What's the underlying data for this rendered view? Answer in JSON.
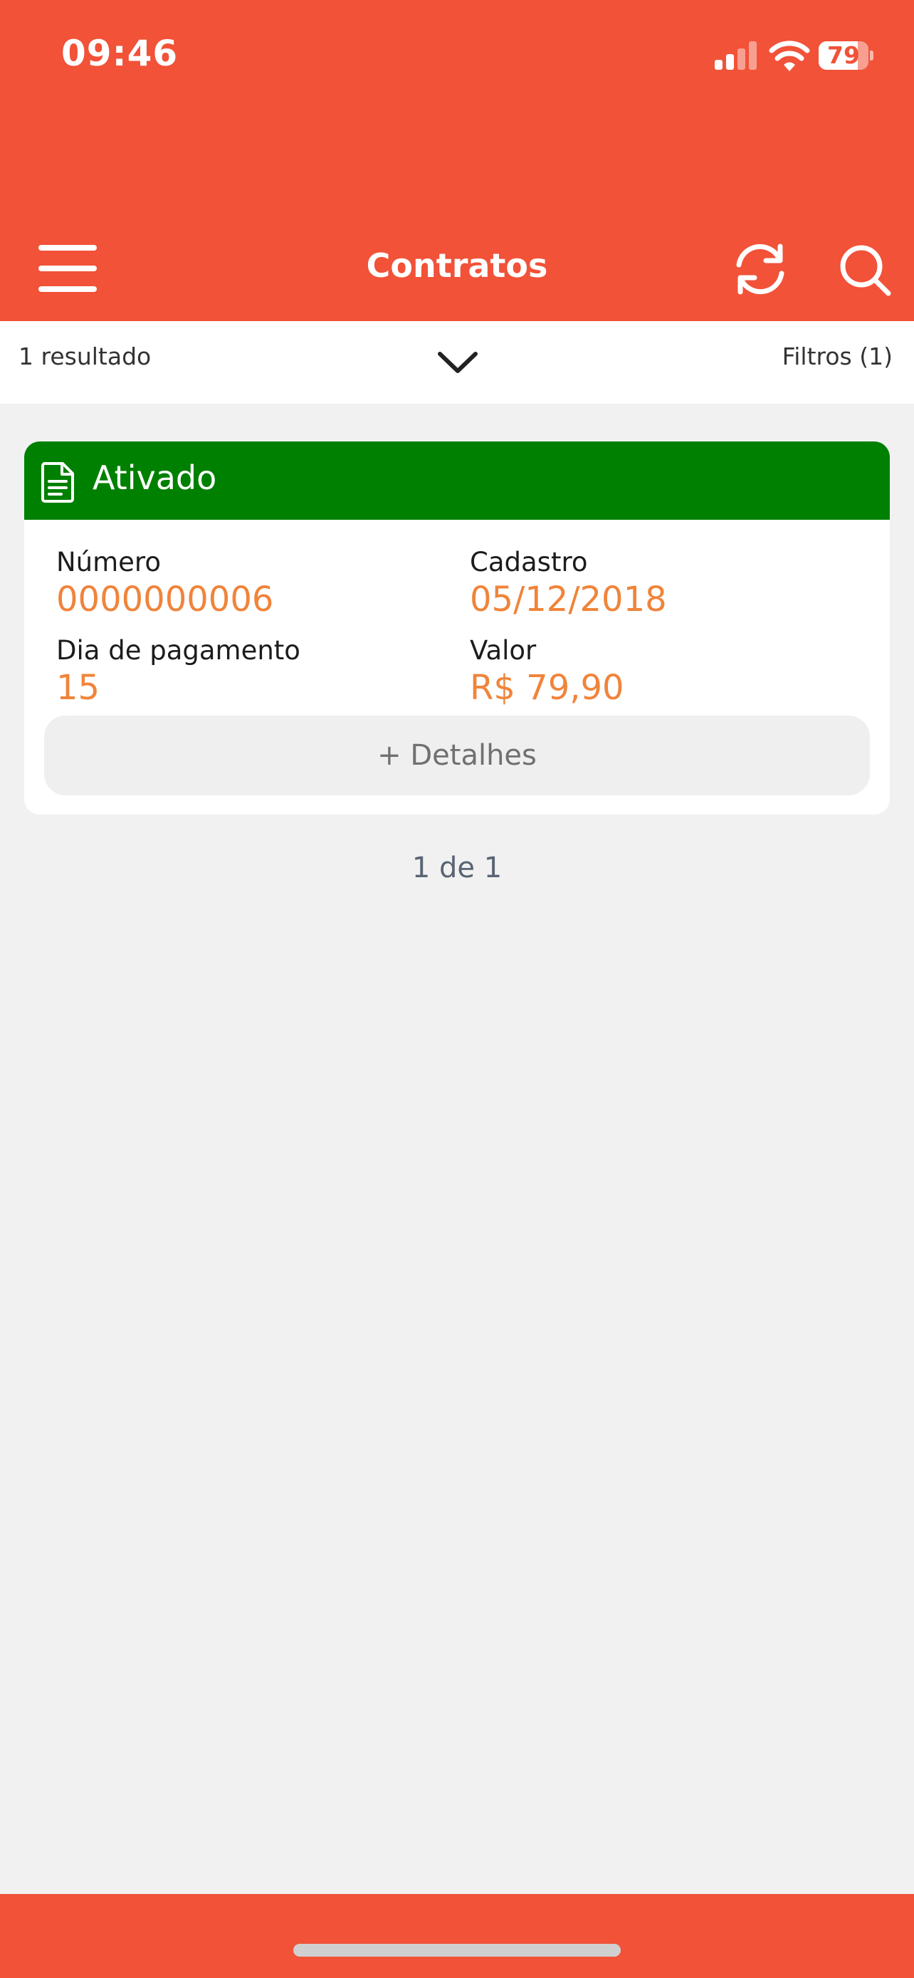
{
  "status_bar": {
    "time": "09:46",
    "battery": "79",
    "battery_level": 0.79
  },
  "header": {
    "title": "Contratos",
    "background_color": "#f15238",
    "menu_icon": "hamburger-menu-icon",
    "refresh_icon": "refresh-icon",
    "search_icon": "search-icon"
  },
  "filter_bar": {
    "result_count": "1 resultado",
    "filters_label": "Filtros (1)",
    "toggle_icon": "chevron-down-icon"
  },
  "contract_card": {
    "status": "Ativado",
    "status_color": "#008000",
    "status_icon": "document-icon",
    "fields": [
      {
        "label": "Número",
        "value": "0000000006"
      },
      {
        "label": "Cadastro",
        "value": "05/12/2018"
      },
      {
        "label": "Dia de pagamento",
        "value": "15"
      },
      {
        "label": "Valor",
        "value": "R$ 79,90"
      }
    ],
    "value_color": "#f0843a",
    "details_button": "+ Detalhes"
  },
  "pagination": {
    "label": "1 de 1"
  }
}
